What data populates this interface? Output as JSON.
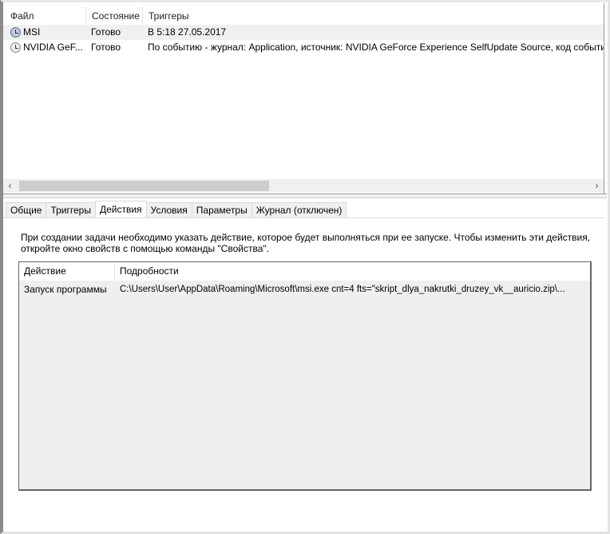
{
  "task_list": {
    "columns": [
      "Файл",
      "Состояние",
      "Триггеры"
    ],
    "rows": [
      {
        "name": "MSI",
        "status": "Готово",
        "trigger": "В 5:18 27.05.2017",
        "icon": "clock-icon"
      },
      {
        "name": "NVIDIA GeF...",
        "status": "Готово",
        "trigger": "По событию - журнал: Application, источник: NVIDIA GeForce Experience SelfUpdate Source, код события:",
        "icon": "clock-icon"
      }
    ],
    "scroll_left": "‹",
    "scroll_right": "›"
  },
  "tabs": [
    "Общие",
    "Триггеры",
    "Действия",
    "Условия",
    "Параметры",
    "Журнал (отключен)"
  ],
  "active_tab": "Действия",
  "actions": {
    "description": "При создании задачи необходимо указать действие, которое будет выполняться при ее запуске.  Чтобы изменить эти действия, откройте окно свойств с помощью команды \"Свойства\".",
    "columns": [
      "Действие",
      "Подробности"
    ],
    "rows": [
      {
        "action": "Запуск программы",
        "details": "C:\\Users\\User\\AppData\\Roaming\\Microsoft\\msi.exe cnt=4 fts=\"skript_dlya_nakrutki_druzey_vk__auricio.zip\\..."
      }
    ]
  }
}
